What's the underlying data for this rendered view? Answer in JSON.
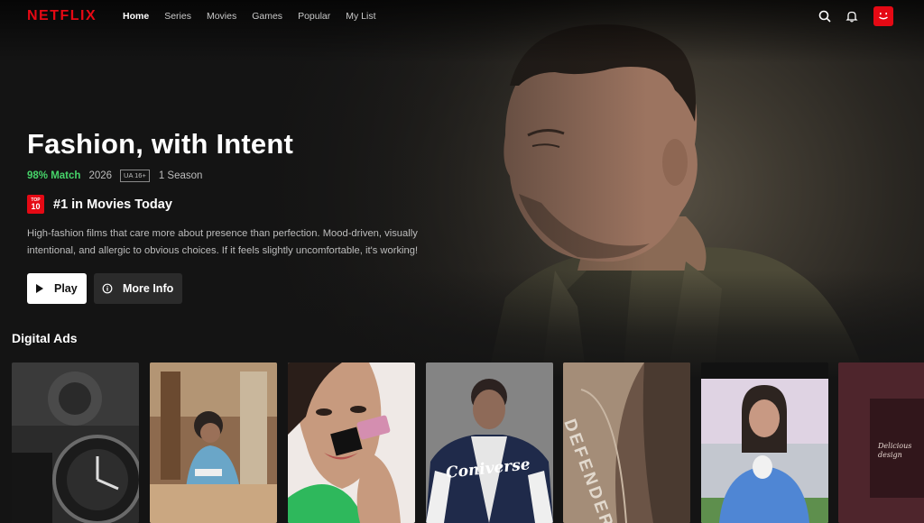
{
  "brand": {
    "logo_text": "NETFLIX"
  },
  "nav": {
    "links": [
      {
        "label": "Home",
        "active": true
      },
      {
        "label": "Series",
        "active": false
      },
      {
        "label": "Movies",
        "active": false
      },
      {
        "label": "Games",
        "active": false
      },
      {
        "label": "Popular",
        "active": false
      },
      {
        "label": "My List",
        "active": false
      }
    ],
    "icons": [
      "search-icon",
      "bell-icon"
    ],
    "avatar_icon": "smiley-face-icon"
  },
  "hero": {
    "title": "Fashion, with Intent",
    "match": "98% Match",
    "year": "2026",
    "rating": "UA 16+",
    "seasons": "1 Season",
    "top10_badge_top": "TOP",
    "top10_badge_bottom": "10",
    "top10_text": "#1 in Movies Today",
    "description": "High-fashion films that care more about presence than perfection. Mood-driven, visually intentional, and allergic to obvious choices. If it feels slightly uncomfortable, it's working!",
    "play_label": "Play",
    "info_label": "More Info"
  },
  "row": {
    "title": "Digital Ads",
    "tiles": [
      {
        "name": "watch-tile",
        "icon": "watch-icon"
      },
      {
        "name": "cafe-tile",
        "icon": "person-icon"
      },
      {
        "name": "lipgloss-tile",
        "icon": "person-icon"
      },
      {
        "name": "varsity-jacket-tile",
        "icon": "person-icon",
        "overlay_text": "Coniverse"
      },
      {
        "name": "defender-tile",
        "icon": "car-icon",
        "overlay_text": "DEFENDER"
      },
      {
        "name": "ball-toss-tile",
        "icon": "person-icon"
      },
      {
        "name": "dessert-tile",
        "icon": "food-icon",
        "overlay_text": "Delicious design"
      }
    ]
  },
  "colors": {
    "brand_red": "#e50914",
    "match_green": "#46d369",
    "background": "#141414"
  }
}
